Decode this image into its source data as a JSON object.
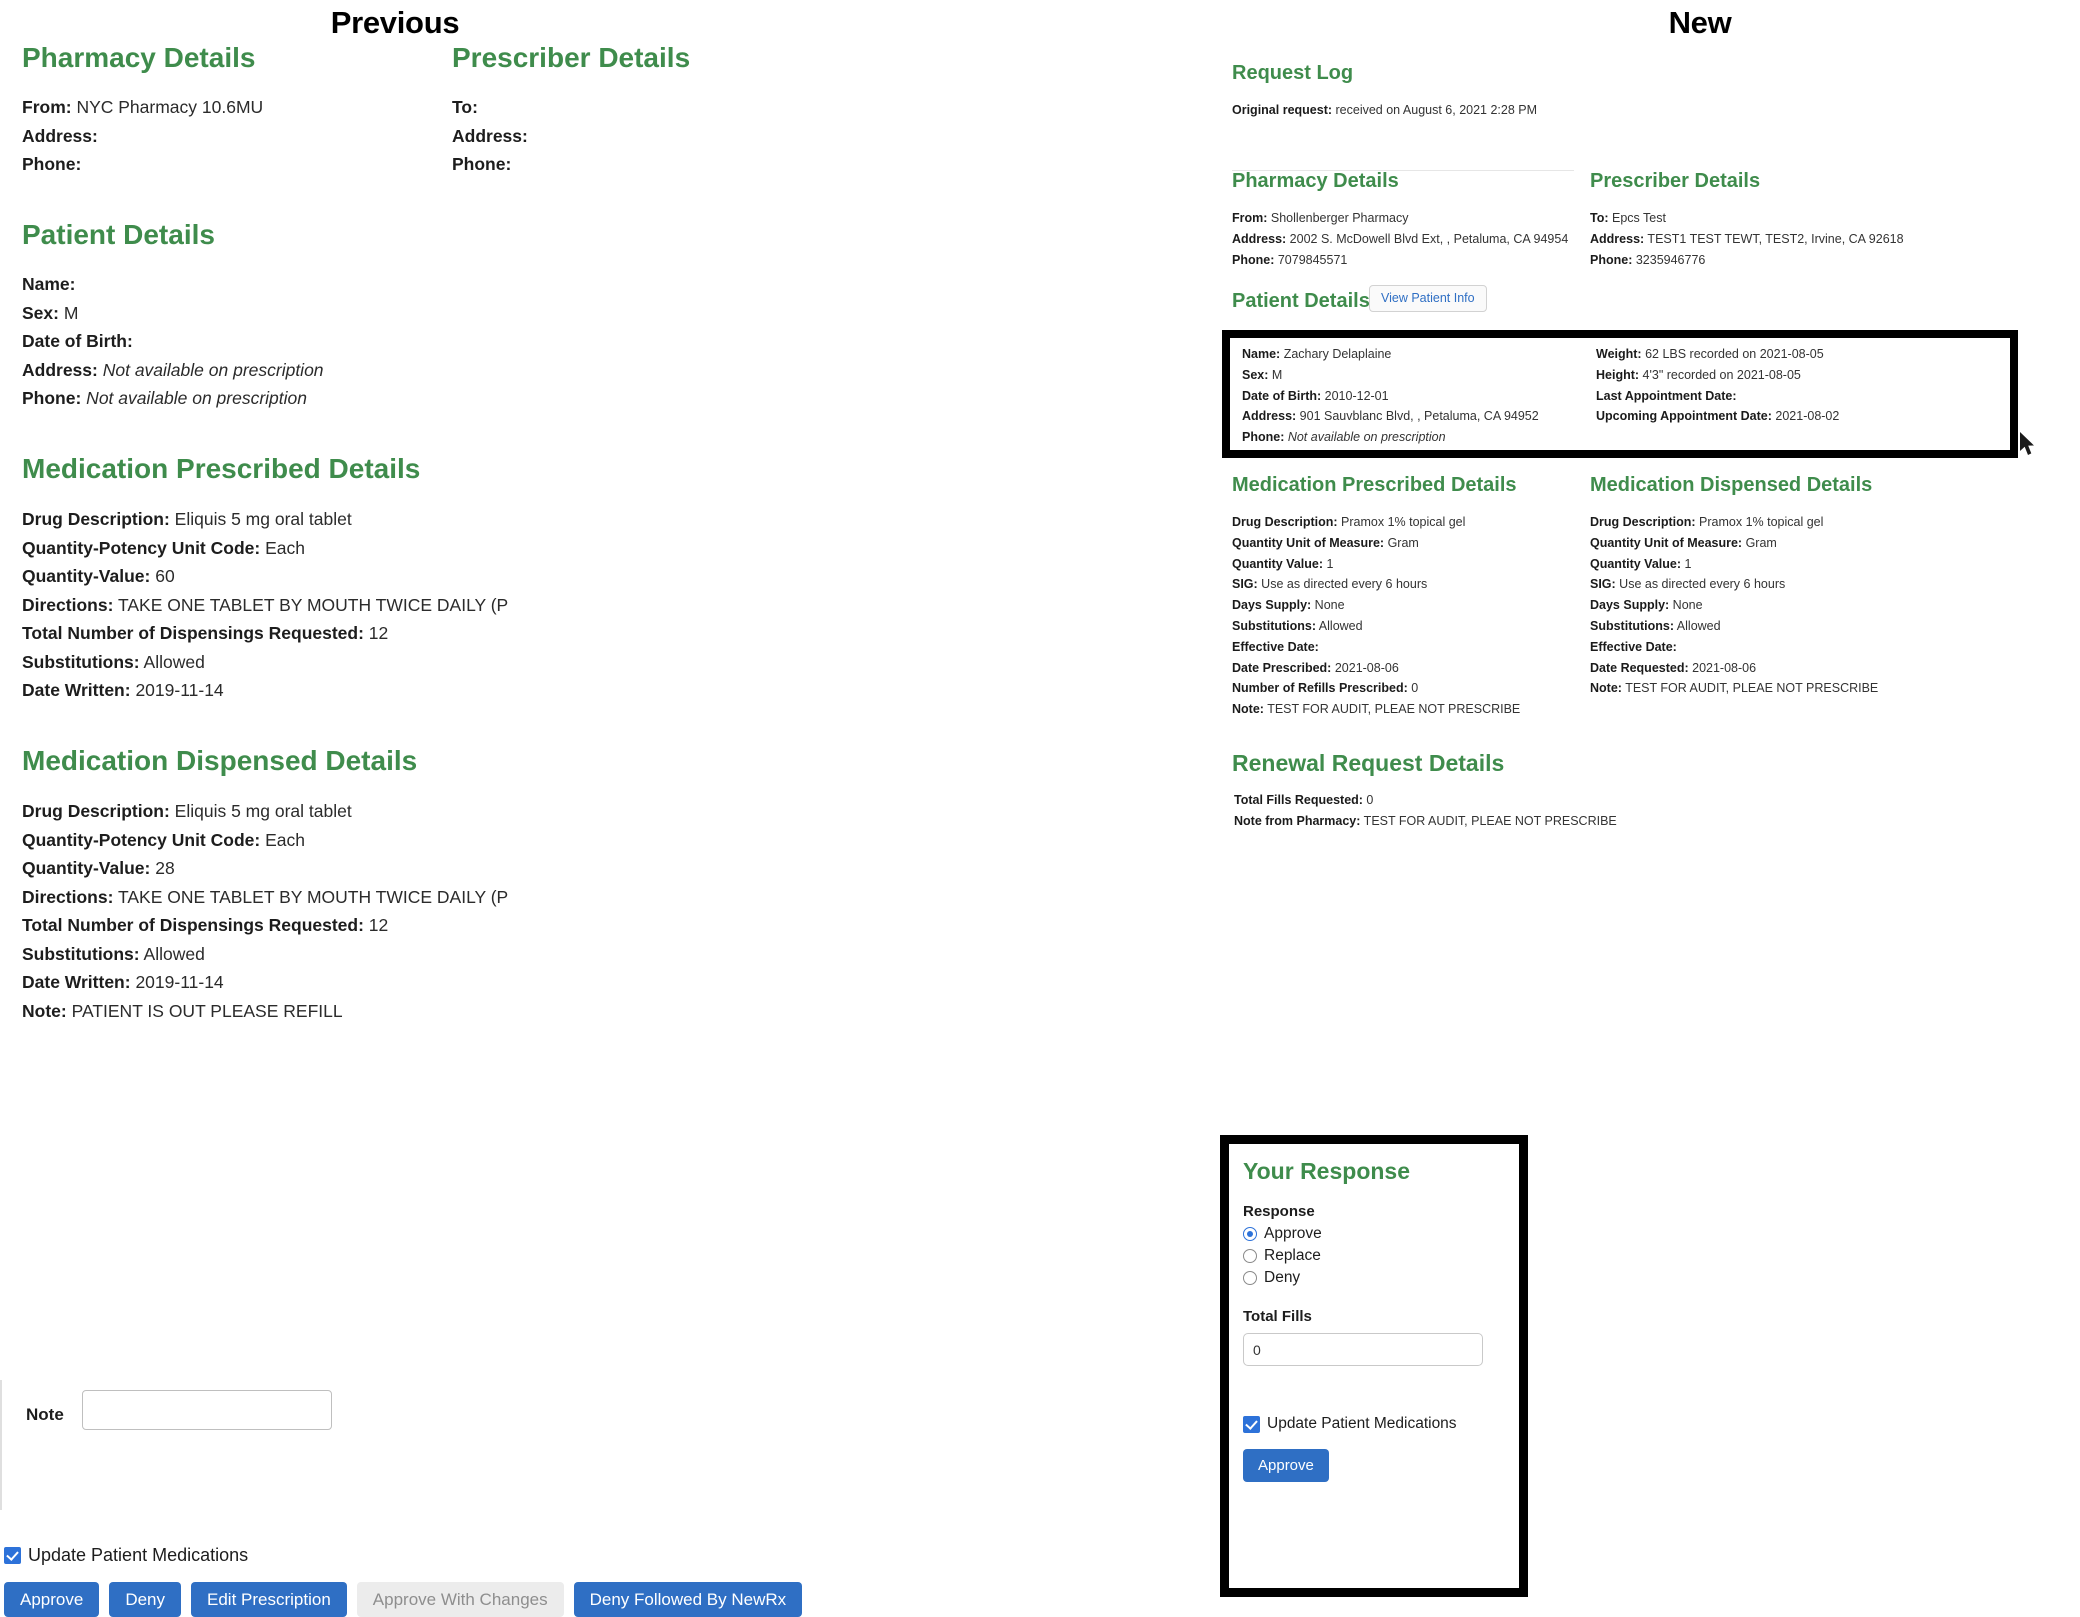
{
  "titles": {
    "previous": "Previous",
    "new": "New"
  },
  "colors": {
    "heading_green": "#3f8c4c",
    "button_blue": "#2f6fc4",
    "link_blue": "#2f6fc4",
    "checkbox_blue": "#2d72d9"
  },
  "previous": {
    "pharmacy": {
      "heading": "Pharmacy Details",
      "rows": [
        {
          "label": "From:",
          "value": "NYC Pharmacy 10.6MU"
        },
        {
          "label": "Address:",
          "value": ""
        },
        {
          "label": "Phone:",
          "value": ""
        }
      ]
    },
    "prescriber": {
      "heading": "Prescriber Details",
      "rows": [
        {
          "label": "To:",
          "value": ""
        },
        {
          "label": "Address:",
          "value": ""
        },
        {
          "label": "Phone:",
          "value": ""
        }
      ]
    },
    "patient": {
      "heading": "Patient Details",
      "rows": [
        {
          "label": "Name:",
          "value": ""
        },
        {
          "label": "Sex:",
          "value": "M"
        },
        {
          "label": "Date of Birth:",
          "value": ""
        },
        {
          "label": "Address:",
          "value": "Not available on prescription",
          "italic": true
        },
        {
          "label": "Phone:",
          "value": "Not available on prescription",
          "italic": true
        }
      ]
    },
    "medication_prescribed": {
      "heading": "Medication Prescribed Details",
      "rows": [
        {
          "label": "Drug Description:",
          "value": "Eliquis 5 mg oral tablet"
        },
        {
          "label": "Quantity-Potency Unit Code:",
          "value": "Each"
        },
        {
          "label": "Quantity-Value:",
          "value": "60"
        },
        {
          "label": "Directions:",
          "value": "TAKE ONE TABLET BY MOUTH TWICE DAILY (P"
        },
        {
          "label": "Total Number of Dispensings Requested:",
          "value": "12"
        },
        {
          "label": "Substitutions:",
          "value": "Allowed"
        },
        {
          "label": "Date Written:",
          "value": "2019-11-14"
        }
      ]
    },
    "medication_dispensed": {
      "heading": "Medication Dispensed Details",
      "rows": [
        {
          "label": "Drug Description:",
          "value": "Eliquis 5 mg oral tablet"
        },
        {
          "label": "Quantity-Potency Unit Code:",
          "value": "Each"
        },
        {
          "label": "Quantity-Value:",
          "value": "28"
        },
        {
          "label": "Directions:",
          "value": "TAKE ONE TABLET BY MOUTH TWICE DAILY (P"
        },
        {
          "label": "Total Number of Dispensings Requested:",
          "value": "12"
        },
        {
          "label": "Substitutions:",
          "value": "Allowed"
        },
        {
          "label": "Date Written:",
          "value": "2019-11-14"
        },
        {
          "label": "Note:",
          "value": "PATIENT IS OUT PLEASE REFILL"
        }
      ]
    },
    "note": {
      "label": "Note",
      "value": "",
      "placeholder": ""
    },
    "update_medications": {
      "label": "Update Patient Medications",
      "checked": true
    },
    "buttons": [
      {
        "label": "Approve",
        "disabled": false
      },
      {
        "label": "Deny",
        "disabled": false
      },
      {
        "label": "Edit Prescription",
        "disabled": false
      },
      {
        "label": "Approve With Changes",
        "disabled": true
      },
      {
        "label": "Deny Followed By NewRx",
        "disabled": false
      }
    ]
  },
  "new": {
    "request_log": {
      "heading": "Request Log",
      "rows": [
        {
          "label": "Original request:",
          "value": "received on August 6, 2021 2:28 PM"
        }
      ]
    },
    "pharmacy": {
      "heading": "Pharmacy Details",
      "rows": [
        {
          "label": "From:",
          "value": "Shollenberger Pharmacy"
        },
        {
          "label": "Address:",
          "value": "2002 S. McDowell Blvd Ext, , Petaluma, CA 94954"
        },
        {
          "label": "Phone:",
          "value": "7079845571"
        }
      ]
    },
    "prescriber": {
      "heading": "Prescriber Details",
      "rows": [
        {
          "label": "To:",
          "value": "Epcs Test"
        },
        {
          "label": "Address:",
          "value": "TEST1 TEST TEWT, TEST2, Irvine, CA 92618"
        },
        {
          "label": "Phone:",
          "value": "3235946776"
        }
      ]
    },
    "patient": {
      "heading": "Patient Details",
      "view_button": "View Patient Info",
      "left_rows": [
        {
          "label": "Name:",
          "value": "Zachary Delaplaine"
        },
        {
          "label": "Sex:",
          "value": "M"
        },
        {
          "label": "Date of Birth:",
          "value": "2010-12-01"
        },
        {
          "label": "Address:",
          "value": "901 Sauvblanc Blvd, , Petaluma, CA 94952"
        },
        {
          "label": "Phone:",
          "value": "Not available on prescription",
          "italic": true
        }
      ],
      "right_rows": [
        {
          "label": "Weight:",
          "value": "62 LBS recorded on 2021-08-05"
        },
        {
          "label": "Height:",
          "value": "4'3\" recorded on 2021-08-05"
        },
        {
          "label": "Last Appointment Date:",
          "value": ""
        },
        {
          "label": "Upcoming Appointment Date:",
          "value": "2021-08-02"
        }
      ]
    },
    "medication_prescribed": {
      "heading": "Medication Prescribed Details",
      "rows": [
        {
          "label": "Drug Description:",
          "value": "Pramox 1% topical gel"
        },
        {
          "label": "Quantity Unit of Measure:",
          "value": "Gram"
        },
        {
          "label": "Quantity Value:",
          "value": "1"
        },
        {
          "label": "SIG:",
          "value": "Use as directed every 6 hours"
        },
        {
          "label": "Days Supply:",
          "value": "None"
        },
        {
          "label": "Substitutions:",
          "value": "Allowed"
        },
        {
          "label": "Effective Date:",
          "value": ""
        },
        {
          "label": "Date Prescribed:",
          "value": "2021-08-06"
        },
        {
          "label": "Number of Refills Prescribed:",
          "value": "0"
        },
        {
          "label": "Note:",
          "value": "TEST FOR AUDIT, PLEAE NOT PRESCRIBE"
        }
      ]
    },
    "medication_dispensed": {
      "heading": "Medication Dispensed Details",
      "rows": [
        {
          "label": "Drug Description:",
          "value": "Pramox 1% topical gel"
        },
        {
          "label": "Quantity Unit of Measure:",
          "value": "Gram"
        },
        {
          "label": "Quantity Value:",
          "value": "1"
        },
        {
          "label": "SIG:",
          "value": "Use as directed every 6 hours"
        },
        {
          "label": "Days Supply:",
          "value": "None"
        },
        {
          "label": "Substitutions:",
          "value": "Allowed"
        },
        {
          "label": "Effective Date:",
          "value": ""
        },
        {
          "label": "Date Requested:",
          "value": "2021-08-06"
        },
        {
          "label": "Note:",
          "value": "TEST FOR AUDIT, PLEAE NOT PRESCRIBE"
        }
      ]
    },
    "renewal": {
      "heading": "Renewal Request Details",
      "rows": [
        {
          "label": "Total Fills Requested:",
          "value": "0"
        },
        {
          "label": "Note from Pharmacy:",
          "value": "TEST FOR AUDIT, PLEAE NOT PRESCRIBE"
        }
      ]
    },
    "response": {
      "heading": "Your Response",
      "response_label": "Response",
      "options": [
        {
          "label": "Approve",
          "selected": true
        },
        {
          "label": "Replace",
          "selected": false
        },
        {
          "label": "Deny",
          "selected": false
        }
      ],
      "total_fills_label": "Total Fills",
      "total_fills_value": "0",
      "update_medications": {
        "label": "Update Patient Medications",
        "checked": true
      },
      "submit_label": "Approve"
    }
  }
}
